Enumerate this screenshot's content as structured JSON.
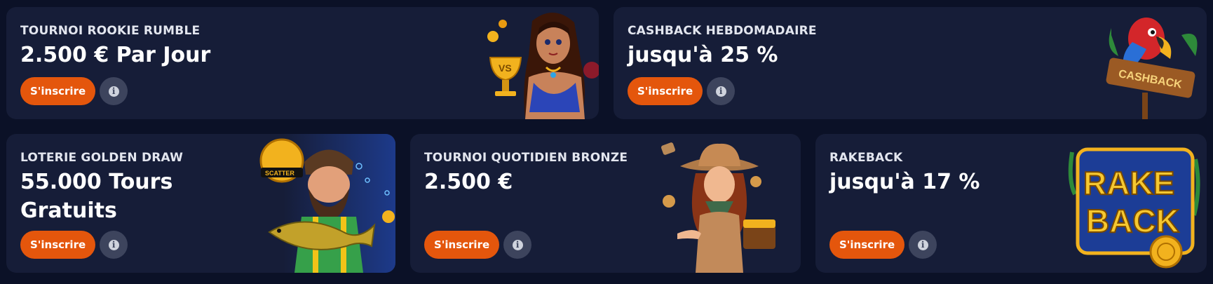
{
  "promotions": [
    {
      "kicker": "TOURNOI ROOKIE RUMBLE",
      "headline": "2.500 € Par Jour",
      "join_label": "S'inscrire",
      "info_glyph": "i",
      "artwork": "genie-woman-with-golden-trophy",
      "trophy_text": "VS"
    },
    {
      "kicker": "CASHBACK HEBDOMADAIRE",
      "headline": "jusqu'à 25 %",
      "join_label": "S'inscrire",
      "info_glyph": "i",
      "artwork": "parrot-on-cashback-sign",
      "sign_text": "CASHBACK"
    },
    {
      "kicker": "LOTERIE GOLDEN DRAW",
      "headline": "55.000 Tours Gratuits",
      "join_label": "S'inscrire",
      "info_glyph": "i",
      "artwork": "fisherman-holding-fish",
      "badge_text": "SCATTER"
    },
    {
      "kicker": "TOURNOI QUOTIDIEN BRONZE",
      "headline": "2.500 €",
      "join_label": "S'inscrire",
      "info_glyph": "i",
      "artwork": "cowgirl-with-gold-chest"
    },
    {
      "kicker": "RAKEBACK",
      "headline": "jusqu'à 17 %",
      "join_label": "S'inscrire",
      "info_glyph": "i",
      "artwork": "rakeback-golden-logo",
      "logo_lines": [
        "RAKE",
        "BACK"
      ]
    }
  ],
  "colors": {
    "page_background": "#0b1127",
    "card_background": "#161d38",
    "join_button": "#e4560c",
    "info_button": "#3d445d",
    "gold": "#f2b21e"
  }
}
